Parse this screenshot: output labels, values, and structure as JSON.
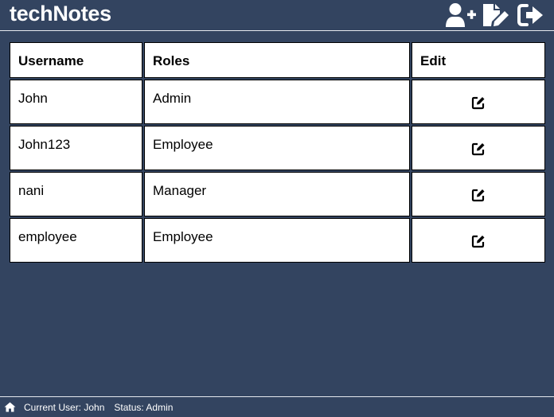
{
  "header": {
    "app_title": "techNotes",
    "icons": [
      "user-plus-icon",
      "file-pen-icon",
      "logout-icon"
    ]
  },
  "table": {
    "columns": [
      "Username",
      "Roles",
      "Edit"
    ],
    "rows": [
      {
        "username": "John",
        "roles": "Admin",
        "edit_icon": "edit-icon"
      },
      {
        "username": "John123",
        "roles": "Employee",
        "edit_icon": "edit-icon"
      },
      {
        "username": "nani",
        "roles": "Manager",
        "edit_icon": "edit-icon"
      },
      {
        "username": "employee",
        "roles": "Employee",
        "edit_icon": "edit-icon"
      }
    ]
  },
  "footer": {
    "home_icon": "home-icon",
    "current_user": "Current User: John",
    "status": "Status: Admin"
  },
  "colors": {
    "background": "#334460",
    "cell_background": "#ffffff",
    "text_dark": "#000000",
    "text_light": "#ffffff"
  }
}
